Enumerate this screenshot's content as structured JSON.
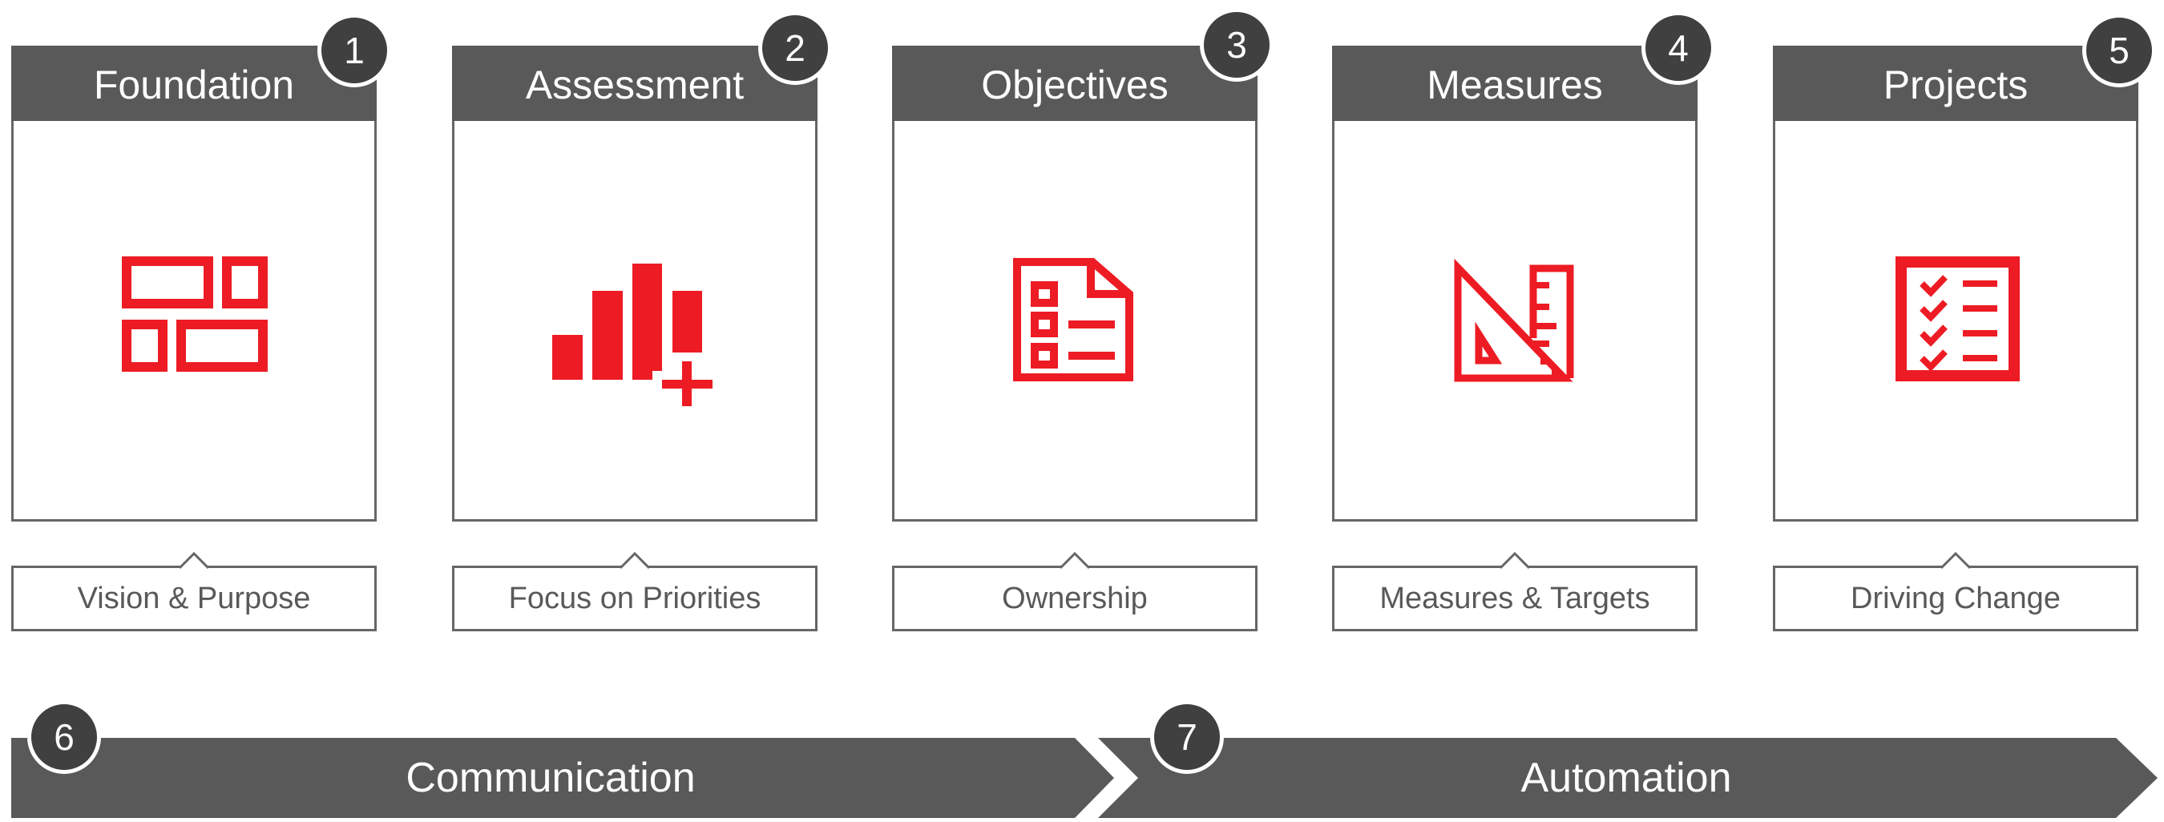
{
  "colors": {
    "header": "#595959",
    "badge": "#404040",
    "icon": "#ED1C24",
    "border": "#666666"
  },
  "steps": [
    {
      "number": "1",
      "title": "Foundation",
      "label": "Vision & Purpose",
      "icon": "building-blocks-icon"
    },
    {
      "number": "2",
      "title": "Assessment",
      "label": "Focus on Priorities",
      "icon": "bar-chart-plus-icon"
    },
    {
      "number": "3",
      "title": "Objectives",
      "label": "Ownership",
      "icon": "document-checklist-icon"
    },
    {
      "number": "4",
      "title": "Measures",
      "label": "Measures & Targets",
      "icon": "ruler-triangle-icon"
    },
    {
      "number": "5",
      "title": "Projects",
      "label": "Driving Change",
      "icon": "checklist-icon"
    }
  ],
  "bars": [
    {
      "number": "6",
      "label": "Communication"
    },
    {
      "number": "7",
      "label": "Automation"
    }
  ]
}
